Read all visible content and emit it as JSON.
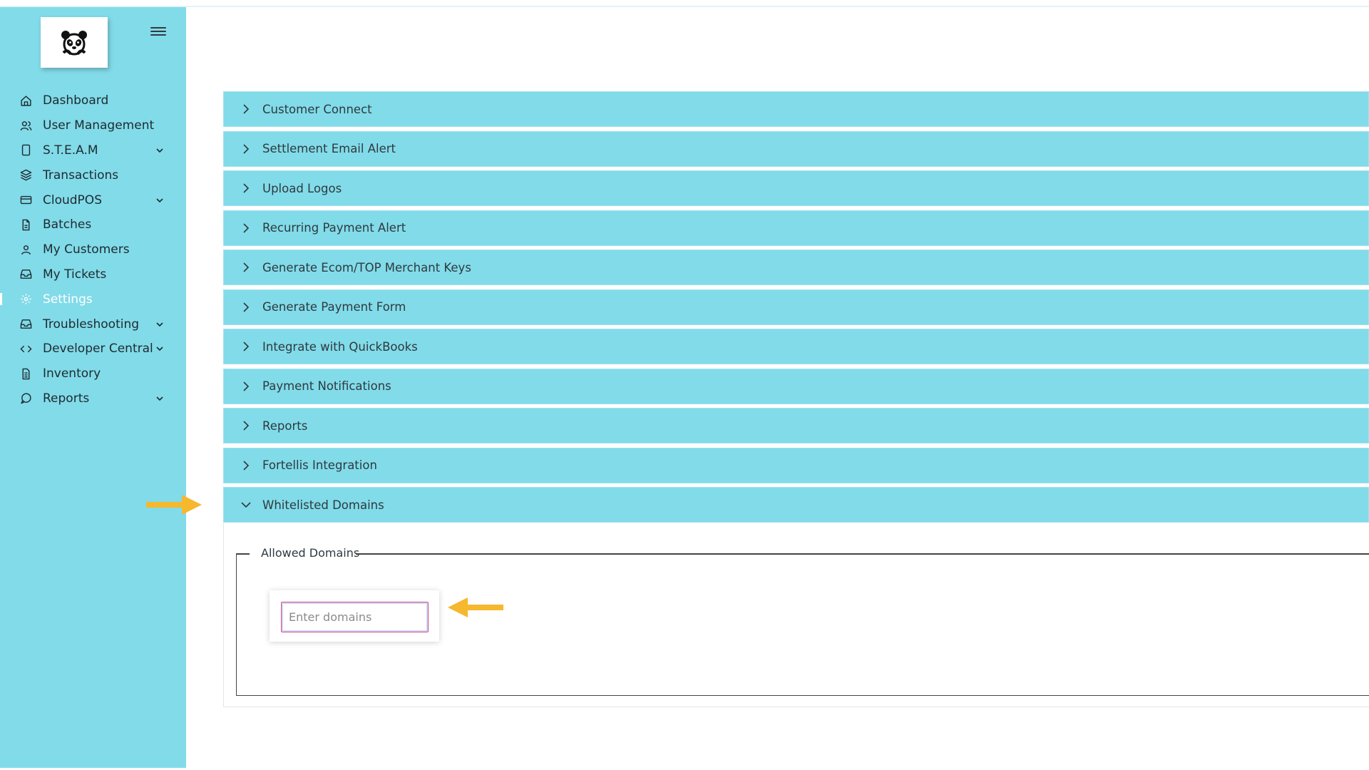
{
  "colors": {
    "sidebar_bg": "#82dbe9",
    "panel_bg": "#82dbe9",
    "active_text": "#ffffff",
    "arrow": "#f5b82e",
    "input_border": "#d44d76"
  },
  "sidebar": {
    "logo_icon": "panda-icon",
    "menu_icon": "hamburger-icon",
    "items": [
      {
        "label": "Dashboard",
        "icon": "home-icon",
        "has_children": false
      },
      {
        "label": "User Management",
        "icon": "users-icon",
        "has_children": false
      },
      {
        "label": "S.T.E.A.M",
        "icon": "tablet-icon",
        "has_children": true
      },
      {
        "label": "Transactions",
        "icon": "layers-icon",
        "has_children": false
      },
      {
        "label": "CloudPOS",
        "icon": "card-icon",
        "has_children": true
      },
      {
        "label": "Batches",
        "icon": "file-icon",
        "has_children": false
      },
      {
        "label": "My Customers",
        "icon": "user-icon",
        "has_children": false
      },
      {
        "label": "My Tickets",
        "icon": "inbox-icon",
        "has_children": false
      },
      {
        "label": "Settings",
        "icon": "gear-icon",
        "has_children": false,
        "active": true
      },
      {
        "label": "Troubleshooting",
        "icon": "inbox-icon",
        "has_children": true
      },
      {
        "label": "Developer Central",
        "icon": "code-icon",
        "has_children": true
      },
      {
        "label": "Inventory",
        "icon": "document-icon",
        "has_children": false
      },
      {
        "label": "Reports",
        "icon": "chat-icon",
        "has_children": true
      }
    ]
  },
  "accordion": {
    "panels": [
      {
        "label": "Customer Connect",
        "expanded": false
      },
      {
        "label": "Settlement Email Alert",
        "expanded": false
      },
      {
        "label": "Upload Logos",
        "expanded": false
      },
      {
        "label": "Recurring Payment Alert",
        "expanded": false
      },
      {
        "label": "Generate Ecom/TOP Merchant Keys",
        "expanded": false
      },
      {
        "label": "Generate Payment Form",
        "expanded": false
      },
      {
        "label": "Integrate with QuickBooks",
        "expanded": false
      },
      {
        "label": "Payment Notifications",
        "expanded": false
      },
      {
        "label": "Reports",
        "expanded": false
      },
      {
        "label": "Fortellis Integration",
        "expanded": false
      },
      {
        "label": "Whitelisted Domains",
        "expanded": true
      }
    ],
    "expanded_section": {
      "legend": "Allowed Domains",
      "input_value": "",
      "input_placeholder": "Enter domains"
    }
  }
}
